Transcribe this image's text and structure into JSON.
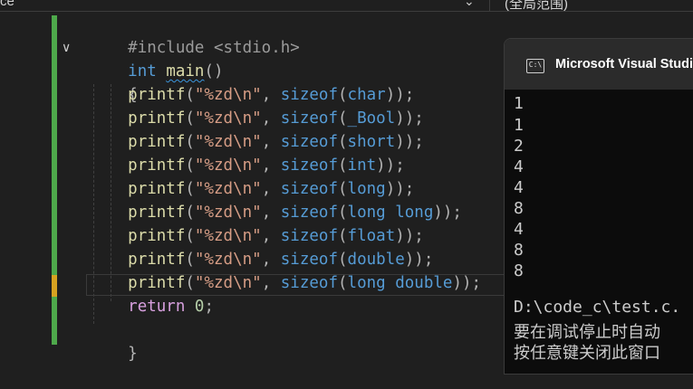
{
  "toolbar": {
    "scope_left": "ce",
    "scope_right": "(全局范围)"
  },
  "editor": {
    "include_directive": "#include",
    "include_header": "<stdio.h>",
    "main_type": "int",
    "main_name": "main",
    "main_parens": "()",
    "open_brace": "{",
    "close_brace": "}",
    "printf_lines": [
      {
        "fn": "printf",
        "fmt": "\"%zd\\n\"",
        "type": "char"
      },
      {
        "fn": "printf",
        "fmt": "\"%zd\\n\"",
        "type": "_Bool"
      },
      {
        "fn": "printf",
        "fmt": "\"%zd\\n\"",
        "type": "short"
      },
      {
        "fn": "printf",
        "fmt": "\"%zd\\n\"",
        "type": "int"
      },
      {
        "fn": "printf",
        "fmt": "\"%zd\\n\"",
        "type": "long"
      },
      {
        "fn": "printf",
        "fmt": "\"%zd\\n\"",
        "type": "long long"
      },
      {
        "fn": "printf",
        "fmt": "\"%zd\\n\"",
        "type": "float"
      },
      {
        "fn": "printf",
        "fmt": "\"%zd\\n\"",
        "type": "double"
      },
      {
        "fn": "printf",
        "fmt": "\"%zd\\n\"",
        "type": "long double"
      }
    ],
    "sizeof_kw": "sizeof",
    "return_kw": "return",
    "return_val": "0"
  },
  "console": {
    "title": "Microsoft Visual Studio",
    "icon": "terminal-icon",
    "output": [
      "1",
      "1",
      "2",
      "4",
      "4",
      "8",
      "4",
      "8",
      "8"
    ],
    "path_line": "D:\\code_c\\test.c.",
    "message_1": "要在调试停止时自动",
    "message_2": "按任意键关闭此窗口"
  },
  "colors": {
    "background": "#1f1f1f",
    "keyword": "#569cd6",
    "function": "#dcdcaa",
    "string": "#d69d85",
    "change_marker": "#4ea94b",
    "cursor_marker": "#d7a221"
  }
}
